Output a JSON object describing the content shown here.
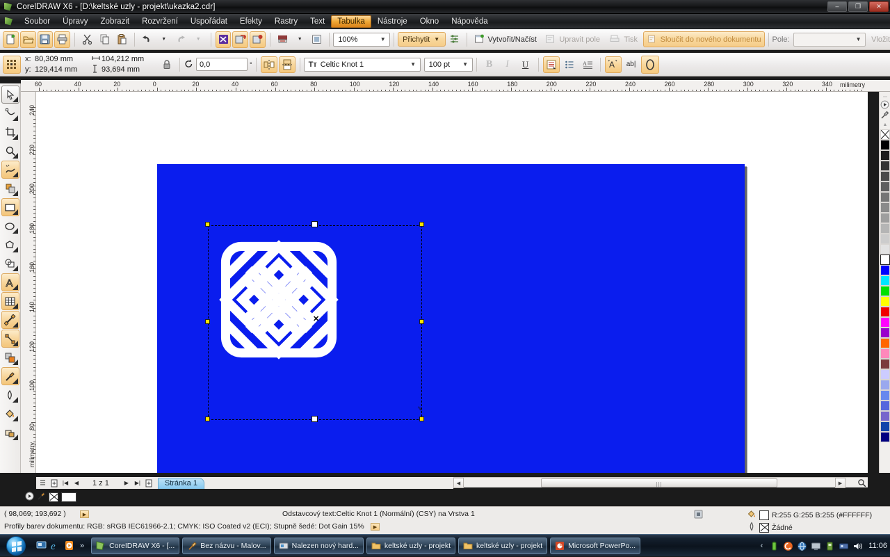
{
  "window": {
    "title": "CorelDRAW X6 - [D:\\keltské uzly - projekt\\ukazka2.cdr]",
    "minimize": "–",
    "maximize": "❐",
    "close": "✕"
  },
  "menubar": {
    "items": [
      {
        "label": "Soubor"
      },
      {
        "label": "Úpravy"
      },
      {
        "label": "Zobrazit"
      },
      {
        "label": "Rozvržení"
      },
      {
        "label": "Uspořádat"
      },
      {
        "label": "Efekty"
      },
      {
        "label": "Rastry"
      },
      {
        "label": "Text"
      },
      {
        "label": "Tabulka"
      },
      {
        "label": "Nástroje"
      },
      {
        "label": "Okno"
      },
      {
        "label": "Nápověda"
      }
    ],
    "active_index": 8
  },
  "standard_toolbar": {
    "buttons": [
      {
        "name": "new-document",
        "icon": "new-file-icon"
      },
      {
        "name": "open-document",
        "icon": "open-folder-icon"
      },
      {
        "name": "save-document",
        "icon": "save-disk-icon"
      },
      {
        "name": "print-document",
        "icon": "printer-icon"
      },
      {
        "name": "cut",
        "icon": "scissors-icon"
      },
      {
        "name": "copy",
        "icon": "copy-icon"
      },
      {
        "name": "paste",
        "icon": "paste-icon"
      },
      {
        "name": "undo",
        "icon": "undo-arrow-icon"
      },
      {
        "name": "redo",
        "icon": "redo-arrow-icon"
      },
      {
        "name": "import",
        "icon": "import-icon"
      },
      {
        "name": "export",
        "icon": "export-icon"
      },
      {
        "name": "publish-pdf",
        "icon": "pdf-icon"
      }
    ],
    "zoom_level": "100%",
    "snap_label": "Přichytit",
    "options_icon": "options-icon"
  },
  "merge_toolbar": {
    "create_load": "Vytvořit/Načíst",
    "edit_field": "Upravit pole",
    "print_label": "Tisk",
    "merge_new_doc": "Sloučit do nového dokumentu",
    "field_label": "Pole:",
    "field_value": "",
    "insert_label": "Vložit"
  },
  "property_bar": {
    "x_label": "x:",
    "x_value": "80,309 mm",
    "y_label": "y:",
    "y_value": "129,414 mm",
    "width_value": "104,212 mm",
    "height_value": "93,694 mm",
    "lock_icon": "lock-ratio-icon",
    "rotation_value": "0,0",
    "rotation_unit": "°",
    "mirror_h_icon": "mirror-horizontal-icon",
    "mirror_v_icon": "mirror-vertical-icon",
    "font_name": "Celtic Knot 1",
    "font_size": "100 pt",
    "bold_icon": "bold-icon",
    "italic_icon": "italic-icon",
    "underline_icon": "underline-icon",
    "align_icon": "text-align-icon",
    "bullet_icon": "bullet-list-icon",
    "dropcap_icon": "drop-cap-icon",
    "char_format_icon": "character-format-icon",
    "edit_text_icon": "edit-text-icon",
    "text_wrap_icon": "text-wrap-icon"
  },
  "toolbox": {
    "tools": [
      {
        "name": "pick-tool",
        "state": "selected"
      },
      {
        "name": "shape-tool",
        "state": "normal"
      },
      {
        "name": "crop-tool",
        "state": "normal"
      },
      {
        "name": "zoom-tool",
        "state": "normal"
      },
      {
        "name": "freehand-tool",
        "state": "amber"
      },
      {
        "name": "smart-fill-tool",
        "state": "normal"
      },
      {
        "name": "rectangle-tool",
        "state": "amber"
      },
      {
        "name": "ellipse-tool",
        "state": "normal"
      },
      {
        "name": "polygon-tool",
        "state": "normal"
      },
      {
        "name": "basic-shapes-tool",
        "state": "normal"
      },
      {
        "name": "text-tool",
        "state": "amber"
      },
      {
        "name": "table-tool",
        "state": "amber"
      },
      {
        "name": "dimension-tool",
        "state": "amber"
      },
      {
        "name": "connector-tool",
        "state": "amber"
      },
      {
        "name": "blend-tool",
        "state": "normal"
      },
      {
        "name": "color-eyedropper-tool",
        "state": "amber"
      },
      {
        "name": "outline-tool",
        "state": "normal"
      },
      {
        "name": "fill-tool",
        "state": "normal"
      },
      {
        "name": "interactive-fill-tool",
        "state": "normal"
      }
    ]
  },
  "rulers": {
    "unit": "milimetry",
    "horizontal_ticks": [
      "60",
      "40",
      "20",
      "0",
      "20",
      "40",
      "60",
      "80",
      "100",
      "120",
      "140",
      "160",
      "180",
      "200",
      "220",
      "240",
      "260",
      "280",
      "300",
      "320",
      "340"
    ],
    "vertical_ticks": [
      "240",
      "220",
      "200",
      "180",
      "160",
      "140",
      "120",
      "100",
      "80"
    ]
  },
  "document": {
    "page_fill_color": "#0a1dee",
    "artwork_color": "#ffffff",
    "artwork_name": "celtic-knot-artwork"
  },
  "page_navigator": {
    "page_counter": "1 z 1",
    "page_tab": "Stránka 1",
    "first_icon": "first-page-icon",
    "prev_icon": "previous-page-icon",
    "next_icon": "next-page-icon",
    "last_icon": "last-page-icon",
    "add_page_left_icon": "add-page-before-icon",
    "add_page_right_icon": "add-page-after-icon"
  },
  "status_bar": {
    "cursor_coords": "( 98,069; 193,692 )",
    "object_info": "Odstavcový text:Celtic Knot 1 (Normální) (CSY) na Vrstva 1",
    "color_profiles": "Profily barev dokumentu: RGB: sRGB IEC61966-2.1; CMYK: ISO Coated v2 (ECI); Stupně šedé: Dot Gain 15%",
    "fill_label": "R:255 G:255 B:255 (#FFFFFF)",
    "outline_label": "Žádné",
    "fill_icon": "fill-bucket-icon",
    "outline_icon": "outline-pen-icon",
    "snap_indicator_icon": "object-indicator-icon"
  },
  "palette": {
    "swatches": [
      "none",
      "#000000",
      "#1c1c1c",
      "#333333",
      "#4a4a4a",
      "#5f5f5f",
      "#757575",
      "#8a8a8a",
      "#9e9e9e",
      "#b5b5b5",
      "#cccccc",
      "#e2e2e2",
      "#ffffff",
      "#0000ff",
      "#00e5ff",
      "#00e000",
      "#ffff00",
      "#f00000",
      "#ff00ff",
      "#9900cc",
      "#ff6600",
      "#ff88bb",
      "#7a3b3b",
      "#ccccff",
      "#9aa8ee",
      "#6688ee",
      "#5566dd",
      "#7766cc",
      "#1144aa",
      "#000080"
    ]
  },
  "taskbar": {
    "start_label": "start-orb",
    "quick_launch": [
      {
        "name": "show-desktop-icon"
      },
      {
        "name": "internet-explorer-icon"
      },
      {
        "name": "media-player-icon"
      }
    ],
    "overflow": "»",
    "tasks": [
      {
        "label": "CoreIDRAW X6 - [...",
        "icon": "coreldraw-icon",
        "active": true
      },
      {
        "label": "Bez názvu - Malov...",
        "icon": "paint-icon",
        "active": false
      },
      {
        "label": "Nalezen nový hard...",
        "icon": "hardware-wizard-icon",
        "active": false
      },
      {
        "label": "keltské uzly - projekt",
        "icon": "folder-icon",
        "active": false
      },
      {
        "label": "keltské uzly - projekt",
        "icon": "folder-icon",
        "active": false
      },
      {
        "label": "Microsoft PowerPo...",
        "icon": "powerpoint-icon",
        "active": false
      }
    ],
    "tray_chevron": "‹",
    "tray_icons": [
      {
        "name": "battery-icon"
      },
      {
        "name": "antivirus-icon"
      },
      {
        "name": "network-globe-icon"
      },
      {
        "name": "display-icon"
      },
      {
        "name": "usb-device-icon"
      },
      {
        "name": "network-icon"
      },
      {
        "name": "volume-icon"
      }
    ],
    "clock": "11:06"
  }
}
